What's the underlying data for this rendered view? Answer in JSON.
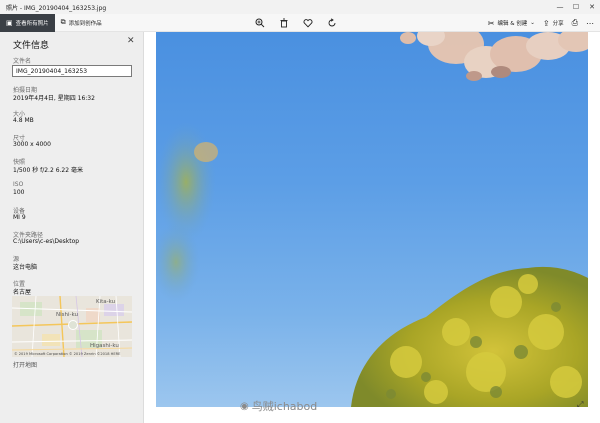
{
  "window": {
    "title": "照片 - IMG_20190404_163253.jpg",
    "minimize_glyph": "—",
    "maximize_glyph": "☐",
    "close_glyph": "✕"
  },
  "toolbar": {
    "see_all_label": "查看所有照片",
    "add_to_creation_label": "添加到创作品",
    "edit_create_label": "编辑 & 创建",
    "share_label": "分享",
    "icons": [
      "zoom-icon",
      "delete-icon",
      "favorite-icon",
      "rotate-icon",
      "edit-icon",
      "share-icon",
      "print-icon",
      "more-icon"
    ]
  },
  "info": {
    "title": "文件信息",
    "close_glyph": "✕",
    "filename_label": "文件名",
    "filename_value": "IMG_20190404_163253",
    "date_label": "拍摄日期",
    "date_value": "2019年4月4日, 星期四 16:32",
    "size_label": "大小",
    "size_value": "4.8 MB",
    "dimensions_label": "尺寸",
    "dimensions_value": "3000 x 4000",
    "shutter_label": "快照",
    "shutter_value": "1/500 秒 f/2.2 6.22 毫米",
    "iso_label": "ISO",
    "iso_value": "100",
    "device_label": "设备",
    "device_value": "MI 9",
    "folder_label": "文件夹路径",
    "folder_value": "C:\\Users\\c-es\\Desktop",
    "source_label": "源",
    "source_value": "这台电脑",
    "location_label": "位置",
    "location_value": "名古屋",
    "map": {
      "labels": [
        "Kita-ku",
        "Nishi-ku",
        "Higashi-ku"
      ],
      "copyright": "© 2019 Microsoft Corporation © 2019 Zenrin ©2018 HERE"
    },
    "open_map_label": "打开地图"
  },
  "watermark": {
    "text": "鸟贼ichabod",
    "icon": "weibo-icon"
  },
  "colors": {
    "active_tab": "#3a3f45",
    "panel_bg": "#eeeeee",
    "sky": "#5c9ee6",
    "foliage": "#b8b62a"
  }
}
